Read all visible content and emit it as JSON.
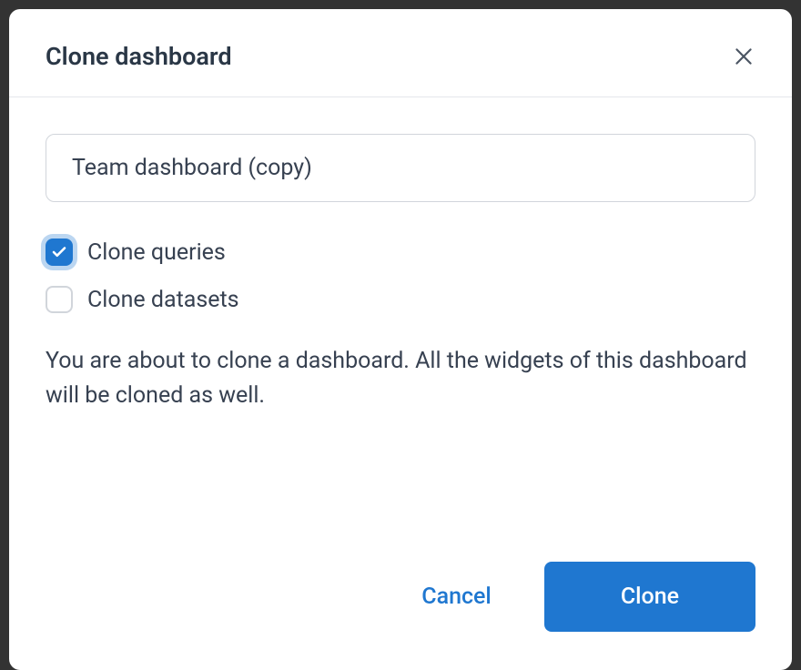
{
  "dialog": {
    "title": "Clone dashboard",
    "name_input": {
      "value": "Team dashboard (copy)",
      "placeholder": ""
    },
    "checkboxes": {
      "clone_queries": {
        "label": "Clone queries",
        "checked": true
      },
      "clone_datasets": {
        "label": "Clone datasets",
        "checked": false
      }
    },
    "description": "You are about to clone a dashboard. All the widgets of this dashboard will be cloned as well.",
    "buttons": {
      "cancel": "Cancel",
      "clone": "Clone"
    }
  }
}
